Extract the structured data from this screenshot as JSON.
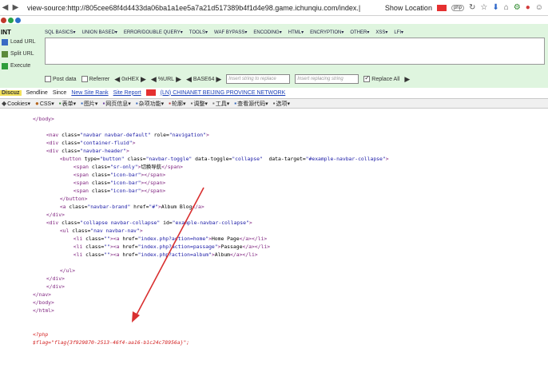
{
  "browser": {
    "url": "view-source:http://805cee68f4d4433da06ba1a1ee5a7a21d517389b4f1d4e98.game.ichunqiu.com/index.|",
    "show_location": "Show Location",
    "php_badge": "php"
  },
  "hackbar": {
    "int_label": "INT",
    "menu": [
      "SQL BASICS▾",
      "UNION BASED▾",
      "ERROR/DOUBLE QUERY▾",
      "TOOLS▾",
      "WAF BYPASS▾",
      "ENCODING▾",
      "HTML▾",
      "ENCRYPTION▾",
      "OTHER▾",
      "XSS▾",
      "LFI▾"
    ],
    "side": [
      "Load URL",
      "Split URL",
      "Execute"
    ],
    "post_data": "Post data",
    "referrer": "Referrer",
    "enc_hex": "0xHEX",
    "enc_url": "%URL",
    "enc_b64": "BASE64",
    "insert_placeholder_1": "Insert string to replace",
    "insert_placeholder_2": "Insert replacing string",
    "replace_all": "Replace All"
  },
  "statusbar": {
    "logo": "Discuz",
    "item1": "Sendline",
    "item2": "Since",
    "link1": "New Site Rank",
    "link2": "Site Report",
    "link3": "(LN) CHINANET BEIJING PROVINCE NETWORK"
  },
  "toolbar2": [
    "Cookies▾",
    "CSS▾",
    "表单▾",
    "图片▾",
    "网页信息▾",
    "杂项功能▾",
    "轮廓▾",
    "调整▾",
    "工具▾",
    "查看源代码▾",
    "选项▾"
  ],
  "source_lines": [
    {
      "indent": 2,
      "parts": [
        [
          "tag",
          "</body>"
        ]
      ]
    },
    {
      "indent": 0,
      "parts": []
    },
    {
      "indent": 4,
      "parts": [
        [
          "tag",
          "<nav "
        ],
        [
          "attr",
          "class="
        ],
        [
          "val",
          "\"navbar navbar-default\""
        ],
        [
          "attr",
          " role="
        ],
        [
          "val",
          "\"navigation\""
        ],
        [
          "tag",
          ">"
        ]
      ]
    },
    {
      "indent": 4,
      "parts": [
        [
          "tag",
          "<div "
        ],
        [
          "attr",
          "class="
        ],
        [
          "val",
          "\"container-fluid\""
        ],
        [
          "tag",
          ">"
        ]
      ]
    },
    {
      "indent": 4,
      "parts": [
        [
          "tag",
          "<div "
        ],
        [
          "attr",
          "class="
        ],
        [
          "val",
          "\"navbar-header\""
        ],
        [
          "tag",
          ">"
        ]
      ]
    },
    {
      "indent": 6,
      "parts": [
        [
          "tag",
          "<button "
        ],
        [
          "attr",
          "type="
        ],
        [
          "val",
          "\"button\""
        ],
        [
          "attr",
          " class="
        ],
        [
          "val",
          "\"navbar-toggle\""
        ],
        [
          "attr",
          " data-toggle="
        ],
        [
          "val",
          "\"collapse\""
        ],
        [
          "attr",
          "  data-target="
        ],
        [
          "val",
          "\"#example-navbar-collapse\""
        ],
        [
          "tag",
          ">"
        ]
      ]
    },
    {
      "indent": 8,
      "parts": [
        [
          "tag",
          "<span "
        ],
        [
          "attr",
          "class="
        ],
        [
          "val",
          "\"sr-only\""
        ],
        [
          "tag",
          ">"
        ],
        [
          "txt",
          "切换导航"
        ],
        [
          "tag",
          "</span>"
        ]
      ]
    },
    {
      "indent": 8,
      "parts": [
        [
          "tag",
          "<span "
        ],
        [
          "attr",
          "class="
        ],
        [
          "val",
          "\"icon-bar\""
        ],
        [
          "tag",
          "></span>"
        ]
      ]
    },
    {
      "indent": 8,
      "parts": [
        [
          "tag",
          "<span "
        ],
        [
          "attr",
          "class="
        ],
        [
          "val",
          "\"icon-bar\""
        ],
        [
          "tag",
          "></span>"
        ]
      ]
    },
    {
      "indent": 8,
      "parts": [
        [
          "tag",
          "<span "
        ],
        [
          "attr",
          "class="
        ],
        [
          "val",
          "\"icon-bar\""
        ],
        [
          "tag",
          "></span>"
        ]
      ]
    },
    {
      "indent": 6,
      "parts": [
        [
          "tag",
          "</button>"
        ]
      ]
    },
    {
      "indent": 6,
      "parts": [
        [
          "tag",
          "<a "
        ],
        [
          "attr",
          "class="
        ],
        [
          "val",
          "\"navbar-brand\""
        ],
        [
          "attr",
          " href="
        ],
        [
          "val",
          "\"#\""
        ],
        [
          "tag",
          ">"
        ],
        [
          "txt",
          "Album Blog"
        ],
        [
          "tag",
          "</a>"
        ]
      ]
    },
    {
      "indent": 4,
      "parts": [
        [
          "tag",
          "</div>"
        ]
      ]
    },
    {
      "indent": 4,
      "parts": [
        [
          "tag",
          "<div "
        ],
        [
          "attr",
          "class="
        ],
        [
          "val",
          "\"collapse navbar-collapse\""
        ],
        [
          "attr",
          " id="
        ],
        [
          "val",
          "\"example-navbar-collapse\""
        ],
        [
          "tag",
          ">"
        ]
      ]
    },
    {
      "indent": 6,
      "parts": [
        [
          "tag",
          "<ul "
        ],
        [
          "attr",
          "class="
        ],
        [
          "val",
          "\"nav navbar-nav\""
        ],
        [
          "tag",
          ">"
        ]
      ]
    },
    {
      "indent": 8,
      "parts": [
        [
          "tag",
          "<li "
        ],
        [
          "attr",
          "class="
        ],
        [
          "val",
          "\"\""
        ],
        [
          "tag",
          "><a "
        ],
        [
          "attr",
          "href="
        ],
        [
          "val",
          "\"index.php?action=home\""
        ],
        [
          "tag",
          ">"
        ],
        [
          "txt",
          "Home Page"
        ],
        [
          "tag",
          "</a></li>"
        ]
      ]
    },
    {
      "indent": 8,
      "parts": [
        [
          "tag",
          "<li "
        ],
        [
          "attr",
          "class="
        ],
        [
          "val",
          "\"\""
        ],
        [
          "tag",
          "><a "
        ],
        [
          "attr",
          "href="
        ],
        [
          "val",
          "\"index.php?action=passage\""
        ],
        [
          "tag",
          ">"
        ],
        [
          "txt",
          "Passage"
        ],
        [
          "tag",
          "</a></li>"
        ]
      ]
    },
    {
      "indent": 8,
      "parts": [
        [
          "tag",
          "<li "
        ],
        [
          "attr",
          "class="
        ],
        [
          "val",
          "\"\""
        ],
        [
          "tag",
          "><a "
        ],
        [
          "attr",
          "href="
        ],
        [
          "val",
          "\"index.php?action=album\""
        ],
        [
          "tag",
          ">"
        ],
        [
          "txt",
          "Album"
        ],
        [
          "tag",
          "</a></li>"
        ]
      ]
    },
    {
      "indent": 0,
      "parts": []
    },
    {
      "indent": 6,
      "parts": [
        [
          "tag",
          "</ul>"
        ]
      ]
    },
    {
      "indent": 4,
      "parts": [
        [
          "tag",
          "</div>"
        ]
      ]
    },
    {
      "indent": 4,
      "parts": [
        [
          "tag",
          "</div>"
        ]
      ]
    },
    {
      "indent": 2,
      "parts": [
        [
          "tag",
          "</nav>"
        ]
      ]
    },
    {
      "indent": 2,
      "parts": [
        [
          "tag",
          "</body>"
        ]
      ]
    },
    {
      "indent": 2,
      "parts": [
        [
          "tag",
          "</html>"
        ]
      ]
    },
    {
      "indent": 0,
      "parts": []
    },
    {
      "indent": 0,
      "parts": []
    },
    {
      "indent": 2,
      "parts": [
        [
          "php",
          "<?php"
        ]
      ]
    },
    {
      "indent": 2,
      "parts": [
        [
          "php",
          "$flag=\"flag{3f929870-2513-46f4-aa16-b1c24c78956a}\";"
        ]
      ]
    }
  ],
  "colors": {
    "hackbar_bg": "#dff5df",
    "tag": "#7d1f7d",
    "value": "#1a1aa6",
    "php": "#d21f1f",
    "arrow": "#d93030"
  }
}
